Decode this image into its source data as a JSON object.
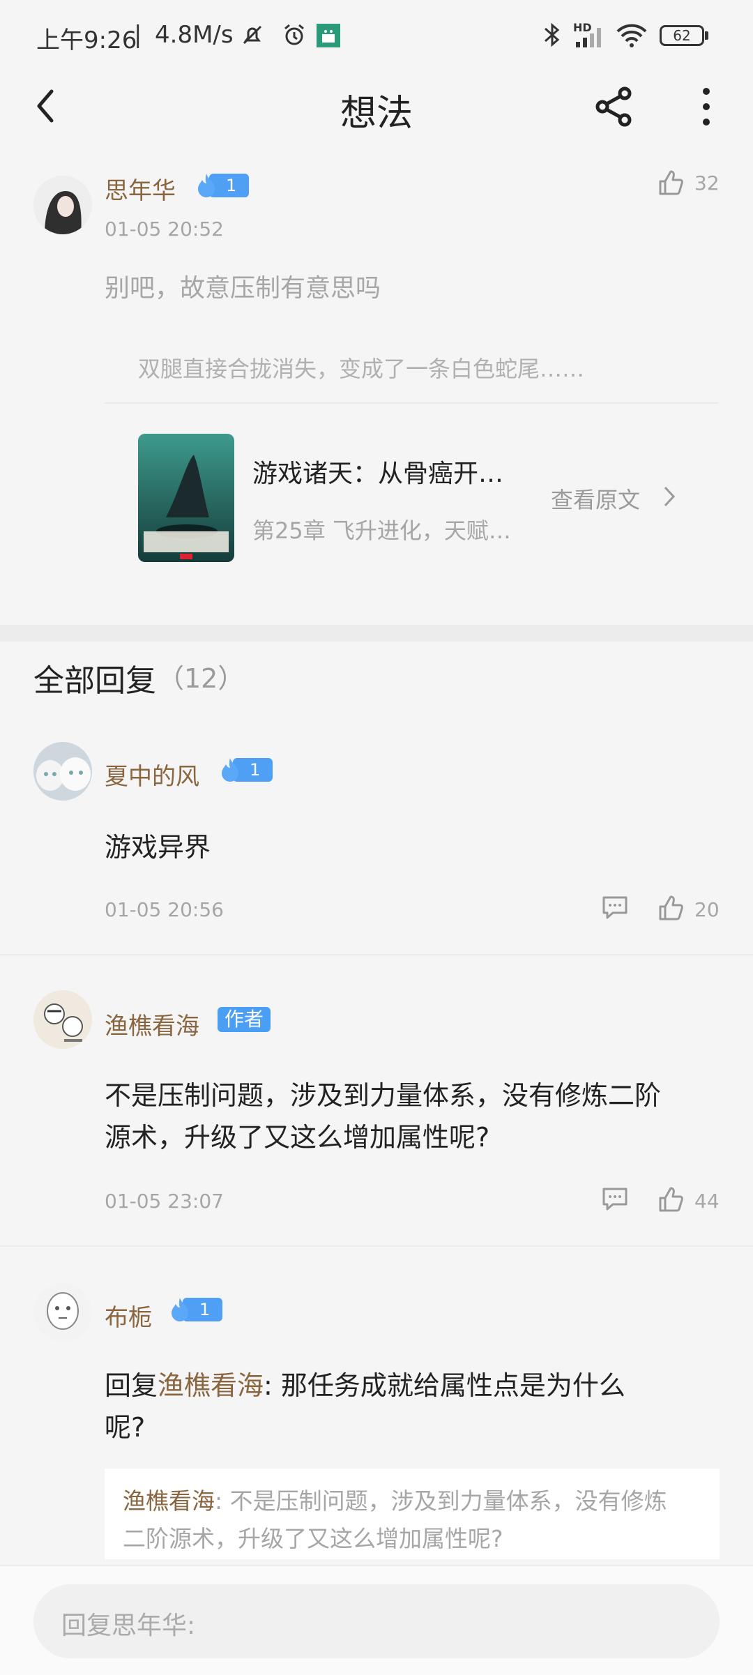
{
  "status_bar": {
    "time": "上午9:26",
    "speed": "4.8M/s",
    "battery": "62",
    "network_label": "HD"
  },
  "header": {
    "title": "想法"
  },
  "post": {
    "author": "思年华",
    "fan_level": "1",
    "date": "01-05 20:52",
    "like_count": "32",
    "content": "别吧，故意压制有意思吗",
    "quote": "双腿直接合拢消失，变成了一条白色蛇尾……",
    "book": {
      "title": "游戏诸天：从骨癌开…",
      "chapter": "第25章 飞升进化，天赋…",
      "view_original": "查看原文"
    }
  },
  "replies_section": {
    "title": "全部回复",
    "count": "（12）"
  },
  "replies": [
    {
      "author": "夏中的风",
      "fan_level": "1",
      "content": "游戏异界",
      "date": "01-05 20:56",
      "likes": "20"
    },
    {
      "author": "渔樵看海",
      "badge": "作者",
      "content_line1": "不是压制问题，涉及到力量体系，没有修炼二阶",
      "content_line2": "源术，升级了又这么增加属性呢?",
      "date": "01-05 23:07",
      "likes": "44"
    },
    {
      "author": "布栀",
      "fan_level": "1",
      "reply_prefix": "回复",
      "reply_to": "渔樵看海",
      "content_rest": ": 那任务成就给属性点是为什么",
      "content_line2": "呢?",
      "quoted_author": "渔樵看海",
      "quoted_line1": ": 不是压制问题，涉及到力量体系，没有修炼",
      "quoted_line2": "二阶源术，升级了又这么增加属性呢?"
    }
  ],
  "reply_input": {
    "placeholder": "回复思年华:"
  },
  "colors": {
    "accent_name": "#8a6640",
    "badge_blue": "#4a9ff5",
    "muted": "#a6a6a6"
  }
}
